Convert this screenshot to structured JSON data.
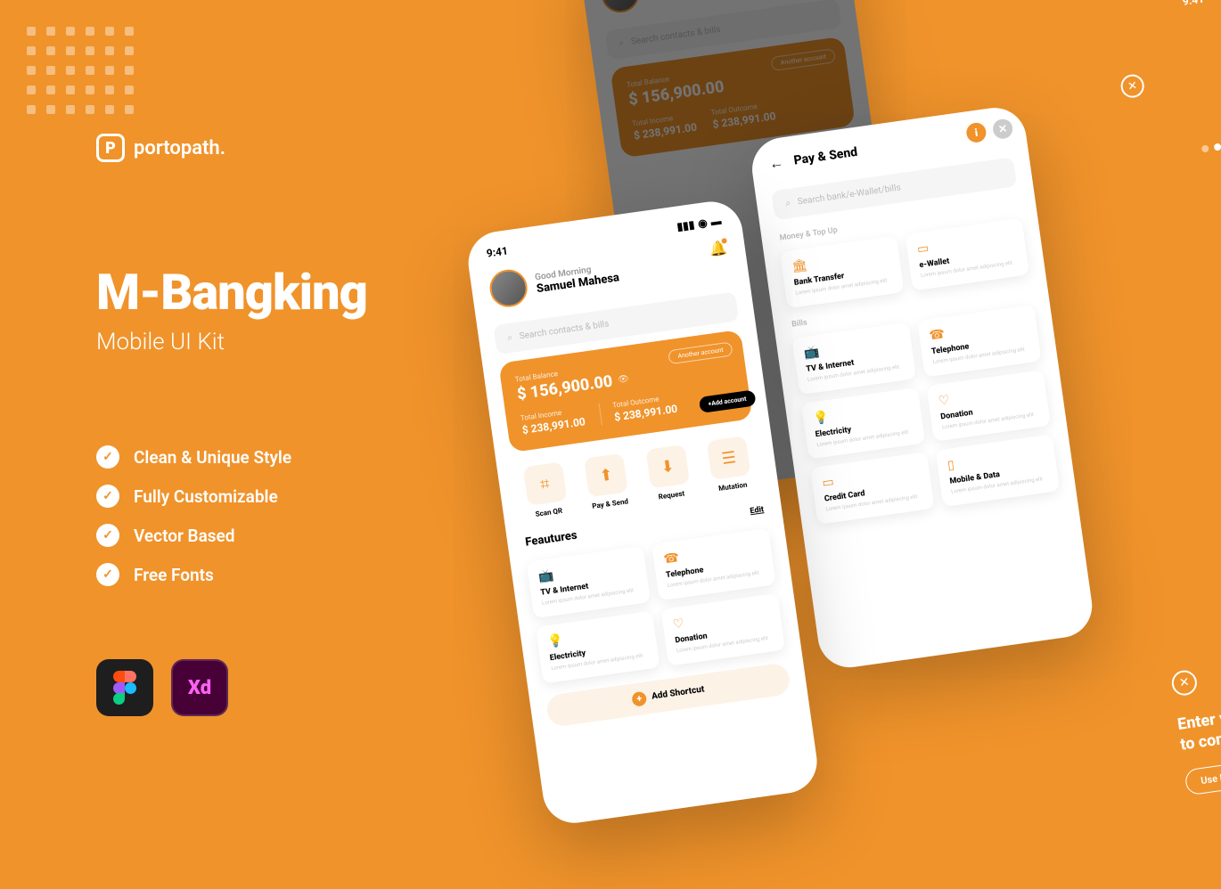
{
  "brand": {
    "name": "portopath."
  },
  "headline": {
    "title": "M-Bangking",
    "subtitle": "Mobile UI Kit"
  },
  "bullets": [
    "Clean & Unique Style",
    "Fully Customizable",
    "Vector Based",
    "Free Fonts"
  ],
  "badges": {
    "xd": "Xd"
  },
  "phone1": {
    "time": "9:41",
    "greeting": "Good Morning",
    "username": "Samuel Mahesa",
    "search_placeholder": "Search contacts & bills",
    "balance": {
      "another_account": "Another account",
      "total_label": "Total Balance",
      "total_amount": "$ 156,900.00",
      "income_label": "Total Income",
      "income_amount": "$ 238,991.00",
      "outcome_label": "Total Outcome",
      "outcome_amount": "$ 238,991.00",
      "add_account": "+Add account"
    },
    "actions": [
      {
        "label": "Scan QR"
      },
      {
        "label": "Pay & Send"
      },
      {
        "label": "Request"
      },
      {
        "label": "Mutation"
      }
    ],
    "features_title": "Feautures",
    "edit": "Edit",
    "features": [
      {
        "title": "TV & Internet"
      },
      {
        "title": "Telephone"
      },
      {
        "title": "Electricity"
      },
      {
        "title": "Donation"
      }
    ],
    "add_shortcut": "Add Shortcut"
  },
  "phone2": {
    "title": "Pay & Send",
    "search_placeholder": "Search bank/e-Wallet/bills",
    "cat1": "Money & Top Up",
    "money_cards": [
      {
        "title": "Bank Transfer"
      },
      {
        "title": "e-Wallet"
      }
    ],
    "cat2": "Bills",
    "bill_cards": [
      {
        "title": "TV & Internet"
      },
      {
        "title": "Telephone"
      },
      {
        "title": "Electricity"
      },
      {
        "title": "Donation"
      },
      {
        "title": "Credit Card"
      },
      {
        "title": "Mobile & Data"
      }
    ]
  },
  "phone_bg": {
    "greeting": "Good Morning",
    "username": "Samuel Mahesa",
    "search_placeholder": "Search contacts & bills",
    "balance_label": "Total Balance",
    "balance_amount": "$ 156,900.00",
    "income_label": "Total Income",
    "income_amount": "$ 238,991.00",
    "outcome_label": "Total Outcome",
    "outcome_amount": "$ 238,991.00",
    "another": "Another account"
  },
  "pin_top": {
    "time": "9:41",
    "line1": "Ente",
    "line2": "to con"
  },
  "pin": {
    "line1": "Enter your PIN",
    "line2": "to confirm payment",
    "use_password": "Use Password"
  },
  "lorem": "Lorem ipsum dolor amet adipiscing elit"
}
